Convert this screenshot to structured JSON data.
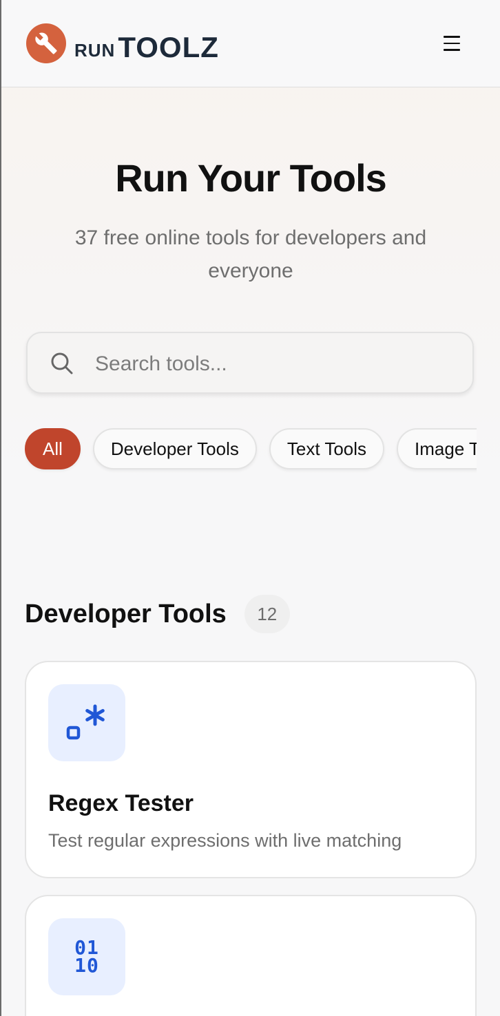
{
  "header": {
    "logo_small": "RUN",
    "logo_big": "TOOLZ",
    "brand_color": "#d4623e",
    "logo_icon": "wrench-icon",
    "menu_icon": "hamburger-menu-icon"
  },
  "hero": {
    "title": "Run Your Tools",
    "subtitle": "37 free online tools for developers and everyone"
  },
  "search": {
    "placeholder": "Search tools...",
    "value": "",
    "icon": "search-icon"
  },
  "categories": {
    "active_color": "#c0452c",
    "items": [
      {
        "label": "All",
        "active": true
      },
      {
        "label": "Developer Tools",
        "active": false
      },
      {
        "label": "Text Tools",
        "active": false
      },
      {
        "label": "Image Tools",
        "active": false
      }
    ]
  },
  "section": {
    "title": "Developer Tools",
    "count": "12"
  },
  "tools": [
    {
      "title": "Regex Tester",
      "description": "Test regular expressions with live matching",
      "icon": "regex-icon",
      "icon_color": "#2057d6"
    },
    {
      "title": "",
      "description": "",
      "icon": "binary-icon",
      "icon_glyph_top": "01",
      "icon_glyph_bottom": "10",
      "icon_color": "#2057d6"
    }
  ]
}
